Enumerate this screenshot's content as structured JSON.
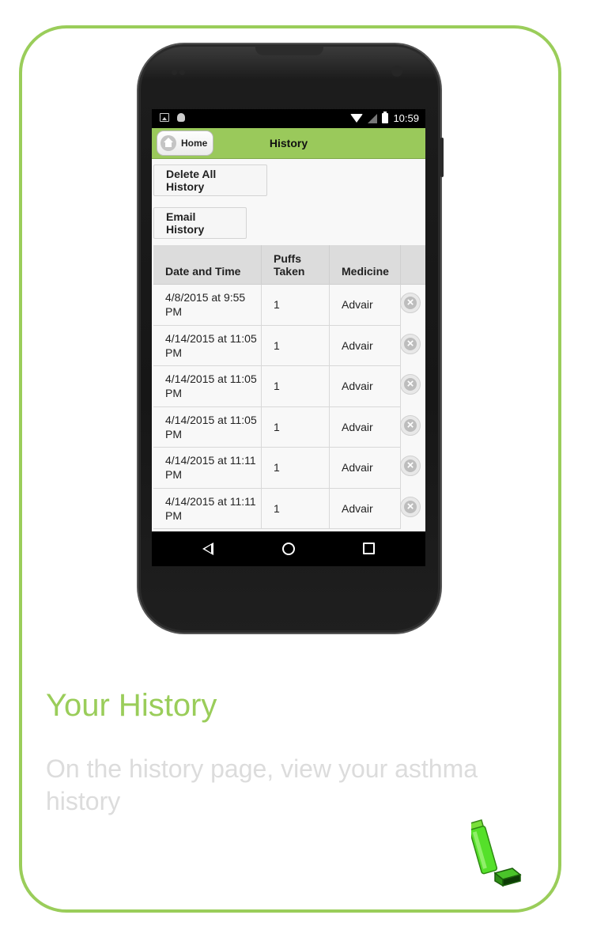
{
  "screen": {
    "status_bar": {
      "time": "10:59"
    },
    "header": {
      "home_label": "Home",
      "title": "History"
    },
    "actions": {
      "delete_all_label": "Delete All History",
      "email_label": "Email History"
    },
    "table": {
      "columns": [
        "Date and Time",
        "Puffs\nTaken",
        "Medicine",
        ""
      ],
      "rows": [
        {
          "date": "4/8/2015 at 9:55 PM",
          "puffs": "1",
          "medicine": "Advair"
        },
        {
          "date": "4/14/2015 at 11:05 PM",
          "puffs": "1",
          "medicine": "Advair"
        },
        {
          "date": "4/14/2015 at 11:05 PM",
          "puffs": "1",
          "medicine": "Advair"
        },
        {
          "date": "4/14/2015 at 11:05 PM",
          "puffs": "1",
          "medicine": "Advair"
        },
        {
          "date": "4/14/2015 at 11:11 PM",
          "puffs": "1",
          "medicine": "Advair"
        },
        {
          "date": "4/14/2015 at 11:11 PM",
          "puffs": "1",
          "medicine": "Advair"
        }
      ]
    }
  },
  "page": {
    "title": "Your History",
    "description": "On the history page, view your asthma history"
  },
  "colors": {
    "accent": "#9acd5a",
    "header_bar": "#9ac95b",
    "desc_text": "#dcdcdc"
  },
  "icons": [
    "home-icon",
    "delete-row-icon",
    "inhaler-icon",
    "wifi-icon",
    "signal-icon",
    "battery-icon",
    "nav-back-icon",
    "nav-home-icon",
    "nav-recent-icon"
  ]
}
